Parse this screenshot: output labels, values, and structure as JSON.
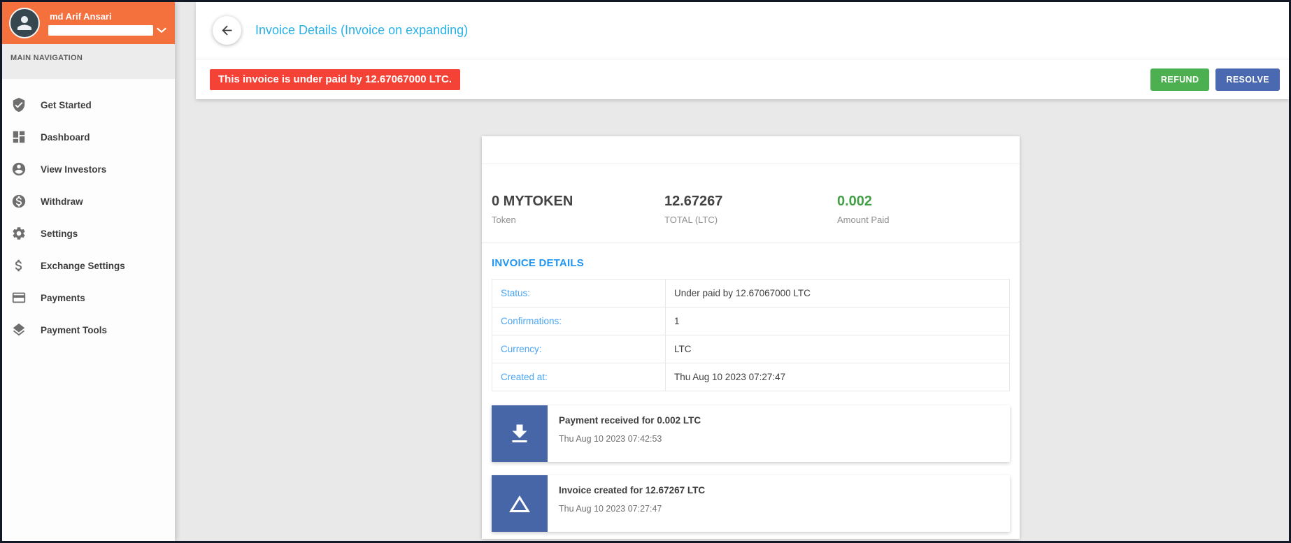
{
  "user": {
    "name": "md Arif Ansari"
  },
  "sidebar": {
    "section_title": "MAIN NAVIGATION",
    "items": [
      {
        "label": "Get Started",
        "icon": "shield-check-icon"
      },
      {
        "label": "Dashboard",
        "icon": "dashboard-grid-icon"
      },
      {
        "label": "View Investors",
        "icon": "person-circle-icon"
      },
      {
        "label": "Withdraw",
        "icon": "dollar-circle-icon"
      },
      {
        "label": "Settings",
        "icon": "gear-icon"
      },
      {
        "label": "Exchange Settings",
        "icon": "dollar-icon"
      },
      {
        "label": "Payments",
        "icon": "credit-card-icon"
      },
      {
        "label": "Payment Tools",
        "icon": "layers-icon"
      }
    ]
  },
  "header": {
    "title": "Invoice Details (Invoice on expanding)",
    "alert": "This invoice is under paid by 12.67067000 LTC.",
    "refund_label": "REFUND",
    "resolve_label": "RESOLVE"
  },
  "invoice": {
    "stats": [
      {
        "value": "0 MYTOKEN",
        "label": "Token",
        "color": "#424242"
      },
      {
        "value": "12.67267",
        "label": "TOTAL (LTC)",
        "color": "#424242"
      },
      {
        "value": "0.002",
        "label": "Amount Paid",
        "color": "#43a047"
      }
    ],
    "section_title": "INVOICE DETAILS",
    "details": [
      {
        "label": "Status:",
        "value": "Under paid by 12.67067000 LTC"
      },
      {
        "label": "Confirmations:",
        "value": "1"
      },
      {
        "label": "Currency:",
        "value": "LTC"
      },
      {
        "label": "Created at:",
        "value": "Thu Aug 10 2023 07:27:47"
      }
    ],
    "events": [
      {
        "icon": "download-icon",
        "title": "Payment received for 0.002 LTC",
        "date": "Thu Aug 10 2023 07:42:53"
      },
      {
        "icon": "triangle-icon",
        "title": "Invoice created for 12.67267 LTC",
        "date": "Thu Aug 10 2023 07:27:47"
      }
    ]
  },
  "colors": {
    "sidebar_header_orange": "#f4703c",
    "avatar_navy": "#37474f",
    "page_title_cyan": "#29b1e8",
    "alert_red": "#f44336",
    "refund_green": "#4caf50",
    "resolve_blue": "#4a69b0",
    "section_heading_blue": "#2095f2",
    "table_label_blue": "#47a5f5",
    "amount_paid_green": "#43a047",
    "event_icon_blue": "#4766a8",
    "page_background": "#e9e9e9"
  }
}
